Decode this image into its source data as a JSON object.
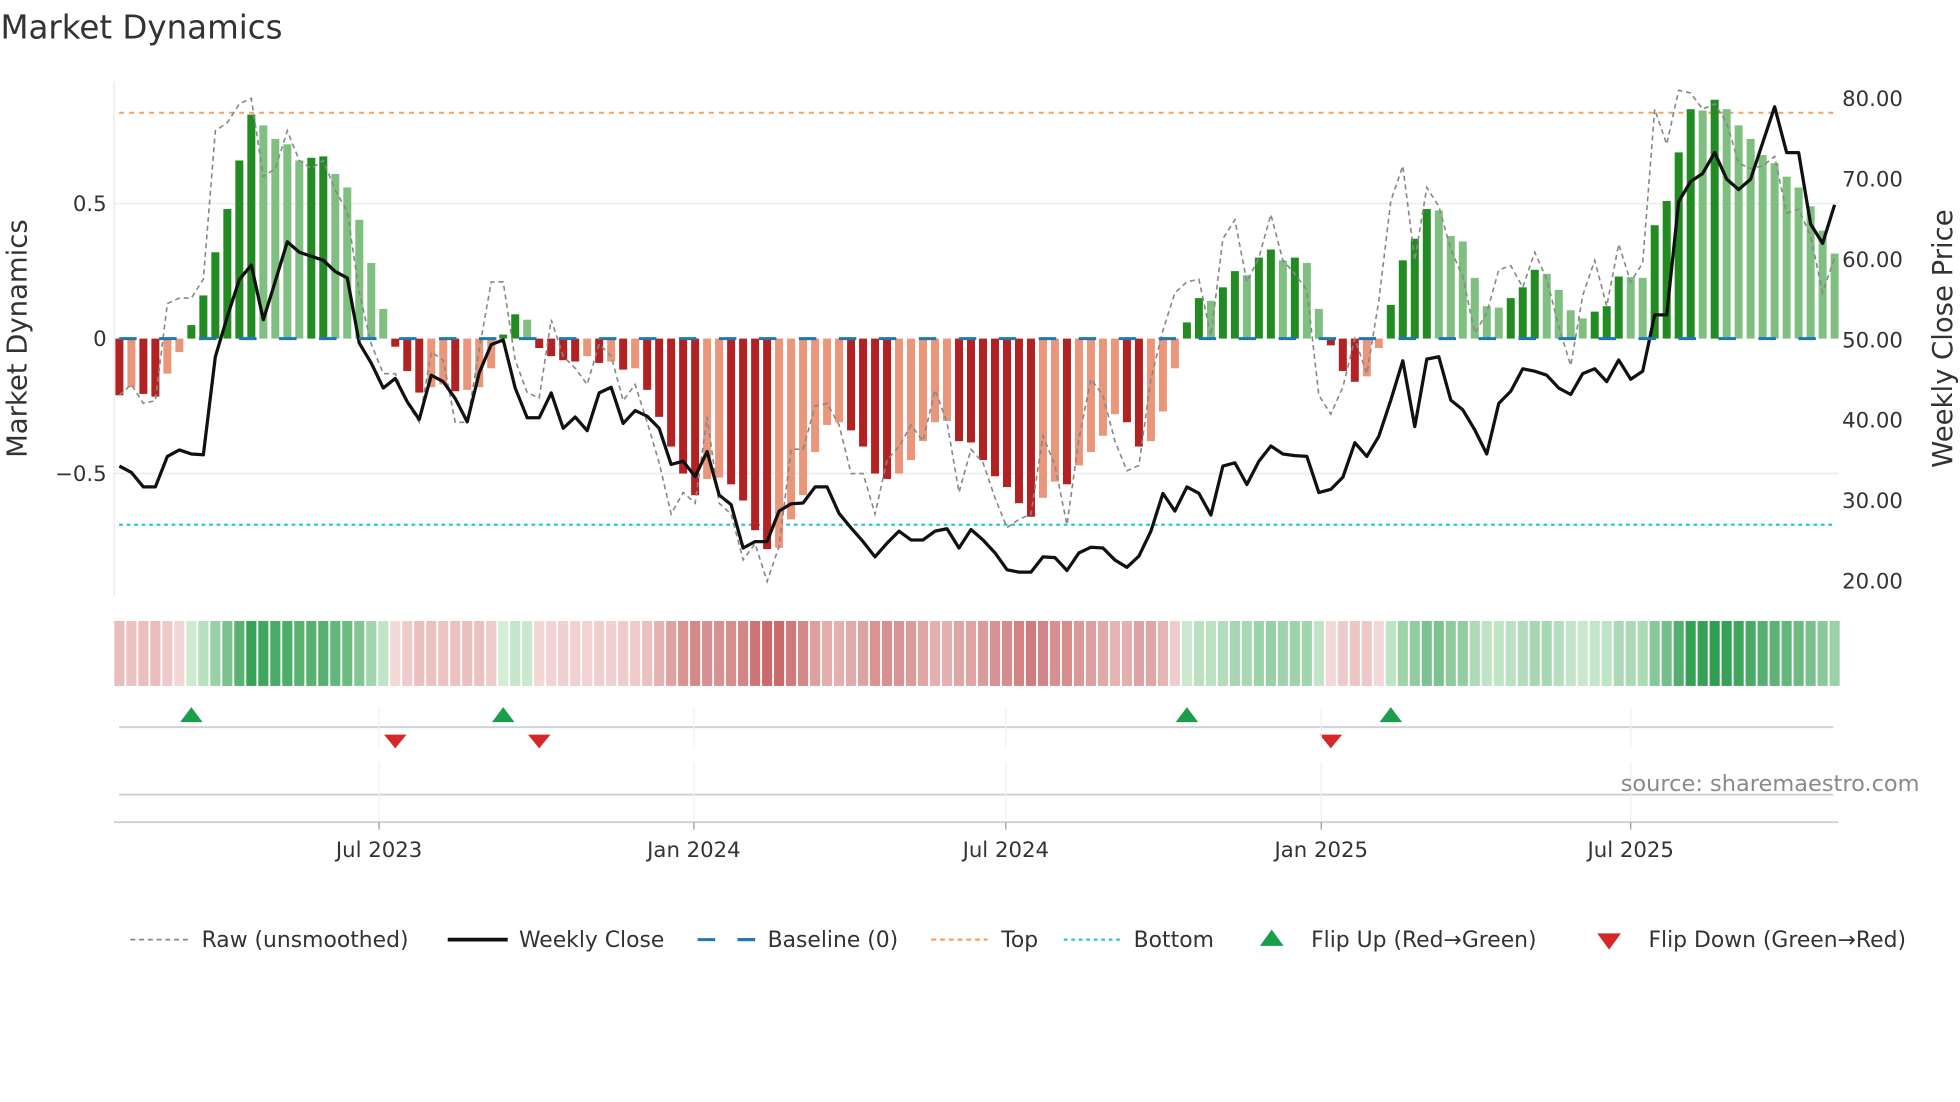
{
  "chart_data": {
    "type": "bar",
    "title": "Market Dynamics",
    "ylabel": "Market Dynamics",
    "y2label": "Weekly Close Price",
    "xlabel": "",
    "ylim": [
      -1.0,
      0.96
    ],
    "y2lim": [
      20.0,
      80.0
    ],
    "grid": true,
    "legend_position": "bottom",
    "source": "source: sharemaestro.com",
    "x_unit": "week index (weekly bars)",
    "x_ticks": [
      {
        "label": "Jul 2023",
        "week": 21.65
      },
      {
        "label": "Jan 2024",
        "week": 47.9
      },
      {
        "label": "Jul 2024",
        "week": 73.9
      },
      {
        "label": "Jan 2025",
        "week": 100.2
      },
      {
        "label": "Jul 2025",
        "week": 126.0
      }
    ],
    "y_ticks": [
      {
        "label": "0.5",
        "value": 0.5
      },
      {
        "label": "0",
        "value": 0
      },
      {
        "label": "−0.5",
        "value": -0.5
      }
    ],
    "y2_ticks": [
      {
        "label": "80.00",
        "value": 80
      },
      {
        "label": "70.00",
        "value": 70
      },
      {
        "label": "60.00",
        "value": 60
      },
      {
        "label": "50.00",
        "value": 50
      },
      {
        "label": "40.00",
        "value": 40
      },
      {
        "label": "30.00",
        "value": 30
      },
      {
        "label": "20.00",
        "value": 20
      }
    ],
    "reference_lines": {
      "baseline": 0,
      "top": 0.837,
      "bottom": -0.69
    },
    "colors": {
      "pos_strong": "#228b22",
      "pos_weak": "#7fbf7f",
      "neg_strong": "#b22222",
      "neg_weak": "#e9967a",
      "raw": "#888888",
      "close": "#111111",
      "baseline": "#1f77b4",
      "top": "#f4a261",
      "bottom": "#2ec4d6",
      "flip_up": "#1a9e4a",
      "flip_down": "#d62728"
    },
    "series": [
      {
        "name": "Market Dynamics (smoothed)",
        "axis": "left",
        "type": "bar",
        "values": [
          -0.21,
          -0.18,
          -0.205,
          -0.215,
          -0.13,
          -0.05,
          0.05,
          0.16,
          0.32,
          0.48,
          0.66,
          0.83,
          0.79,
          0.74,
          0.72,
          0.66,
          0.67,
          0.675,
          0.61,
          0.56,
          0.44,
          0.28,
          0.11,
          -0.03,
          -0.12,
          -0.2,
          -0.18,
          -0.17,
          -0.195,
          -0.19,
          -0.18,
          -0.11,
          0.015,
          0.09,
          0.07,
          -0.035,
          -0.065,
          -0.08,
          -0.085,
          -0.065,
          -0.09,
          -0.085,
          -0.115,
          -0.11,
          -0.19,
          -0.29,
          -0.4,
          -0.5,
          -0.58,
          -0.52,
          -0.515,
          -0.54,
          -0.6,
          -0.71,
          -0.78,
          -0.775,
          -0.67,
          -0.58,
          -0.42,
          -0.32,
          -0.31,
          -0.34,
          -0.4,
          -0.5,
          -0.52,
          -0.5,
          -0.45,
          -0.38,
          -0.31,
          -0.305,
          -0.38,
          -0.385,
          -0.45,
          -0.51,
          -0.55,
          -0.61,
          -0.66,
          -0.59,
          -0.53,
          -0.54,
          -0.47,
          -0.42,
          -0.36,
          -0.28,
          -0.31,
          -0.4,
          -0.38,
          -0.27,
          -0.11,
          0.06,
          0.15,
          0.14,
          0.19,
          0.25,
          0.235,
          0.3,
          0.33,
          0.29,
          0.3,
          0.28,
          0.11,
          -0.025,
          -0.12,
          -0.16,
          -0.14,
          -0.035,
          0.125,
          0.29,
          0.37,
          0.48,
          0.475,
          0.38,
          0.36,
          0.225,
          0.12,
          0.115,
          0.15,
          0.19,
          0.255,
          0.24,
          0.18,
          0.105,
          0.075,
          0.1,
          0.12,
          0.23,
          0.228,
          0.225,
          0.42,
          0.51,
          0.69,
          0.85,
          0.845,
          0.885,
          0.85,
          0.79,
          0.74,
          0.68,
          0.65,
          0.6,
          0.56,
          0.49,
          0.4,
          0.315
        ]
      },
      {
        "name": "Raw (unsmoothed)",
        "axis": "left",
        "type": "line",
        "values": [
          -0.21,
          -0.17,
          -0.24,
          -0.23,
          0.13,
          0.15,
          0.15,
          0.22,
          0.77,
          0.8,
          0.87,
          0.89,
          0.6,
          0.63,
          0.77,
          0.66,
          0.63,
          0.66,
          0.55,
          0.47,
          0.17,
          -0.02,
          -0.13,
          -0.13,
          -0.24,
          -0.31,
          -0.05,
          -0.08,
          -0.31,
          -0.31,
          -0.04,
          0.21,
          0.21,
          -0.08,
          -0.2,
          -0.22,
          0.07,
          -0.065,
          -0.11,
          -0.17,
          -0.02,
          -0.065,
          -0.23,
          -0.17,
          -0.31,
          -0.46,
          -0.65,
          -0.57,
          -0.61,
          -0.29,
          -0.61,
          -0.65,
          -0.82,
          -0.76,
          -0.9,
          -0.77,
          -0.41,
          -0.41,
          -0.25,
          -0.24,
          -0.32,
          -0.5,
          -0.5,
          -0.65,
          -0.45,
          -0.4,
          -0.32,
          -0.38,
          -0.19,
          -0.31,
          -0.57,
          -0.41,
          -0.46,
          -0.59,
          -0.7,
          -0.67,
          -0.65,
          -0.36,
          -0.47,
          -0.69,
          -0.37,
          -0.15,
          -0.21,
          -0.38,
          -0.49,
          -0.47,
          -0.15,
          0.03,
          0.17,
          0.21,
          0.22,
          0.01,
          0.37,
          0.44,
          0.21,
          0.3,
          0.46,
          0.29,
          0.24,
          0.18,
          -0.21,
          -0.28,
          -0.18,
          0.0,
          -0.13,
          0.14,
          0.51,
          0.64,
          0.29,
          0.56,
          0.49,
          0.33,
          0.23,
          0.02,
          0.095,
          0.255,
          0.27,
          0.19,
          0.32,
          0.22,
          0.045,
          -0.1,
          0.16,
          0.29,
          0.12,
          0.35,
          0.21,
          0.28,
          0.85,
          0.72,
          0.92,
          0.91,
          0.85,
          0.87,
          0.8,
          0.65,
          0.63,
          0.64,
          0.675,
          0.465,
          0.48,
          0.38,
          0.17,
          0.3
        ]
      },
      {
        "name": "Weekly Close",
        "axis": "right",
        "type": "line",
        "values": [
          34.3,
          33.5,
          31.7,
          31.7,
          35.5,
          36.3,
          35.8,
          35.7,
          47.9,
          52.9,
          57.5,
          59.3,
          52.5,
          57.3,
          62.2,
          60.9,
          60.4,
          59.9,
          58.5,
          57.7,
          49.6,
          47.1,
          44.0,
          45.2,
          42.3,
          40.1,
          45.6,
          44.8,
          42.7,
          39.8,
          45.9,
          49.4,
          50.0,
          44.0,
          40.3,
          40.3,
          43.4,
          39.0,
          40.4,
          38.7,
          43.4,
          44.1,
          39.6,
          41.2,
          40.5,
          39.0,
          34.5,
          34.9,
          33.0,
          36.1,
          30.7,
          29.5,
          24.1,
          24.9,
          24.9,
          28.7,
          29.6,
          29.7,
          31.7,
          31.7,
          28.4,
          26.6,
          24.9,
          23.0,
          24.7,
          26.2,
          25.1,
          25.1,
          26.2,
          26.5,
          24.1,
          26.4,
          25.1,
          23.5,
          21.4,
          21.1,
          21.1,
          23.0,
          22.9,
          21.3,
          23.5,
          24.2,
          24.1,
          22.6,
          21.7,
          23.1,
          26.2,
          30.9,
          28.7,
          31.7,
          30.9,
          28.2,
          34.3,
          34.7,
          32.0,
          34.9,
          36.8,
          35.8,
          35.6,
          35.5,
          31.0,
          31.4,
          32.9,
          37.2,
          35.5,
          38.0,
          42.5,
          47.4,
          39.2,
          47.6,
          47.9,
          42.5,
          41.3,
          38.8,
          35.8,
          42.1,
          43.6,
          46.4,
          46.1,
          45.6,
          44.0,
          43.2,
          45.8,
          46.4,
          44.8,
          47.5,
          45.1,
          46.1,
          53.1,
          53.1,
          67.2,
          69.7,
          70.7,
          73.3,
          70.0,
          68.7,
          70.0,
          74.5,
          79.0,
          73.3,
          73.3,
          64.4,
          62.0,
          66.8
        ]
      }
    ],
    "legend": [
      {
        "label": "Raw (unsmoothed)",
        "marker": "dashed-line"
      },
      {
        "label": "Weekly Close",
        "marker": "solid-line"
      },
      {
        "label": "Baseline (0)",
        "marker": "dashed-line"
      },
      {
        "label": "Top",
        "marker": "dotted-line"
      },
      {
        "label": "Bottom",
        "marker": "dotted-line"
      },
      {
        "label": "Flip Up (Red→Green)",
        "marker": "triangle-up"
      },
      {
        "label": "Flip Down (Green→Red)",
        "marker": "triangle-down"
      }
    ]
  }
}
